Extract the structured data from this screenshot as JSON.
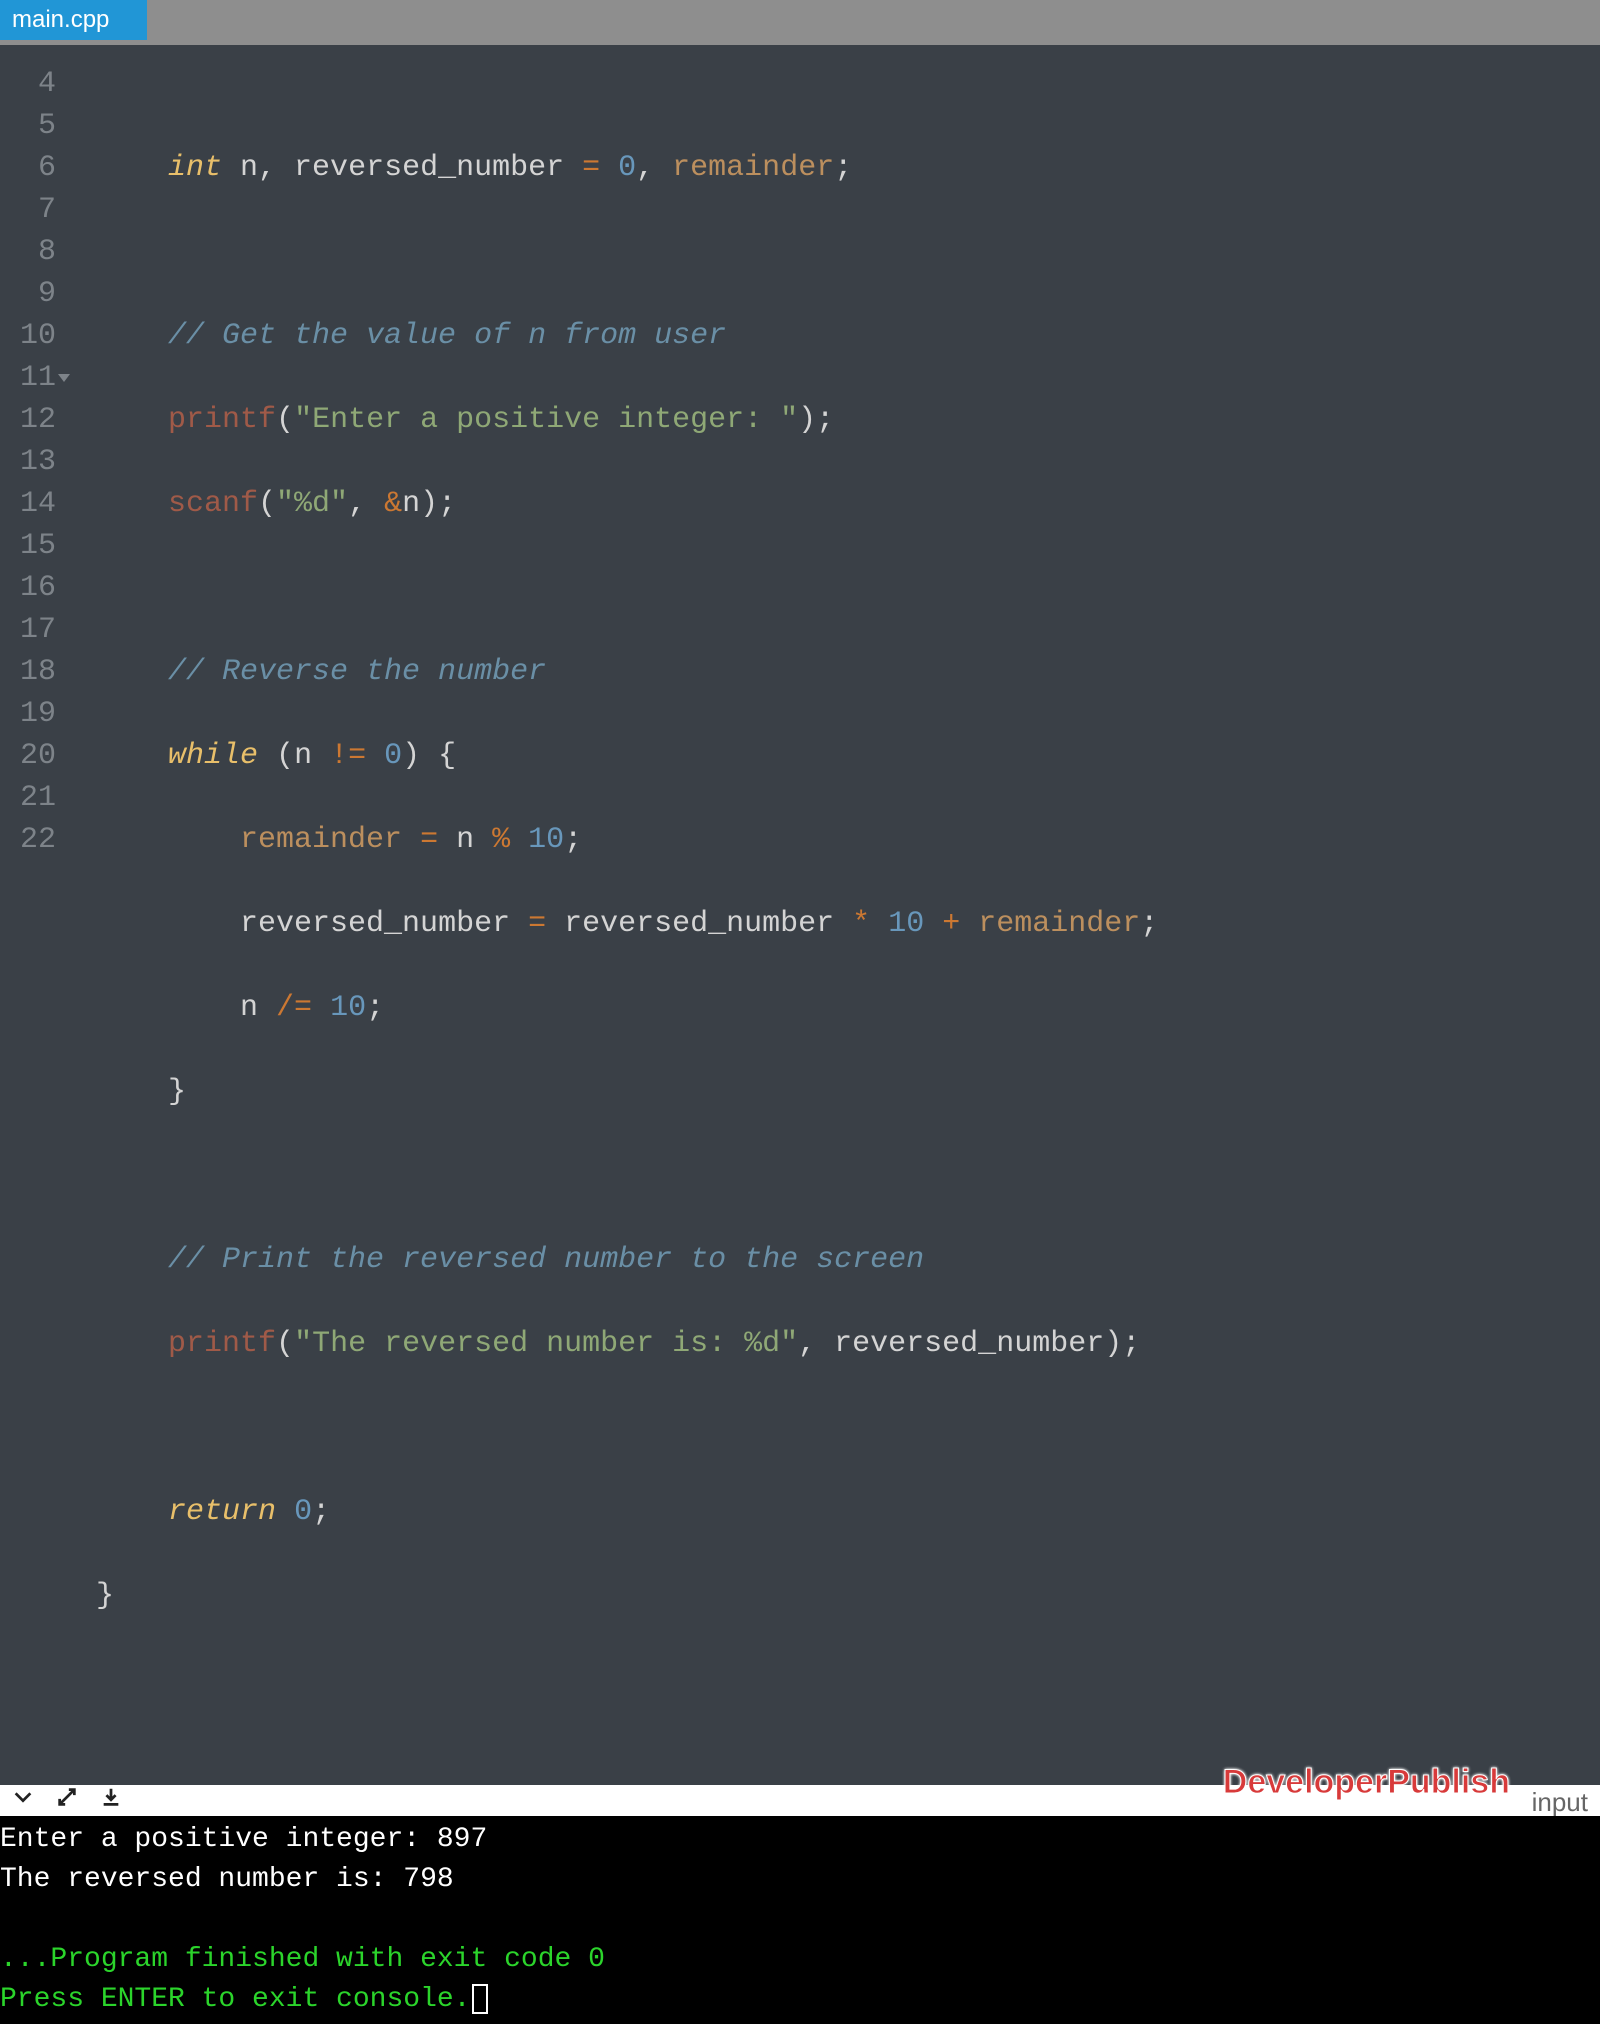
{
  "tab": {
    "filename": "main.cpp"
  },
  "gutter": {
    "lines": [
      "4",
      "5",
      "6",
      "7",
      "8",
      "9",
      "10",
      "11",
      "12",
      "13",
      "14",
      "15",
      "16",
      "17",
      "18",
      "19",
      "20",
      "21",
      "22"
    ],
    "fold_at": "11"
  },
  "code": {
    "l4": {
      "indent": "    ",
      "type": "int",
      "sp": " ",
      "vars1": "n, reversed_number ",
      "op1": "=",
      "sp2": " ",
      "num": "0",
      "comma": ", ",
      "var2": "remainder",
      "semi": ";"
    },
    "l6": {
      "indent": "    ",
      "txt": "// Get the value of n from user"
    },
    "l7": {
      "indent": "    ",
      "fn": "printf",
      "p1": "(",
      "str": "\"Enter a positive integer: \"",
      "p2": ")",
      "semi": ";"
    },
    "l8": {
      "indent": "    ",
      "fn": "scanf",
      "p1": "(",
      "str": "\"%d\"",
      "comma": ", ",
      "amp": "&",
      "var": "n",
      "p2": ")",
      "semi": ";"
    },
    "l10": {
      "indent": "    ",
      "txt": "// Reverse the number"
    },
    "l11": {
      "indent": "    ",
      "kw": "while",
      "sp": " ",
      "p1": "(",
      "var": "n ",
      "op": "!=",
      "sp2": " ",
      "num": "0",
      "p2": ")",
      "sp3": " ",
      "brace": "{"
    },
    "l12": {
      "indent": "        ",
      "var": "remainder",
      "sp": " ",
      "op": "=",
      "sp2": " n ",
      "op2": "%",
      "sp3": " ",
      "num": "10",
      "semi": ";"
    },
    "l13": {
      "indent": "        ",
      "txt1": "reversed_number ",
      "op1": "=",
      "txt2": " reversed_number ",
      "op2": "*",
      "sp": " ",
      "num": "10",
      "sp2": " ",
      "op3": "+",
      "sp3": " ",
      "var": "remainder",
      "semi": ";"
    },
    "l14": {
      "indent": "        ",
      "txt": "n ",
      "op": "/=",
      "sp": " ",
      "num": "10",
      "semi": ";"
    },
    "l15": {
      "indent": "    ",
      "brace": "}"
    },
    "l17": {
      "indent": "    ",
      "txt": "// Print the reversed number to the screen"
    },
    "l18": {
      "indent": "    ",
      "fn": "printf",
      "p1": "(",
      "str": "\"The reversed number is: %d\"",
      "comma": ", reversed_number",
      "p2": ")",
      "semi": ";"
    },
    "l20": {
      "indent": "    ",
      "kw": "return",
      "sp": " ",
      "num": "0",
      "semi": ";"
    },
    "l21": {
      "brace": "}"
    }
  },
  "watermark": "DeveloperPublish",
  "panel": {
    "right_label": "input"
  },
  "console": {
    "line1": "Enter a positive integer: 897",
    "line2": "The reversed number is: 798",
    "line3": "",
    "line4": "...Program finished with exit code 0",
    "line5": "Press ENTER to exit console."
  }
}
